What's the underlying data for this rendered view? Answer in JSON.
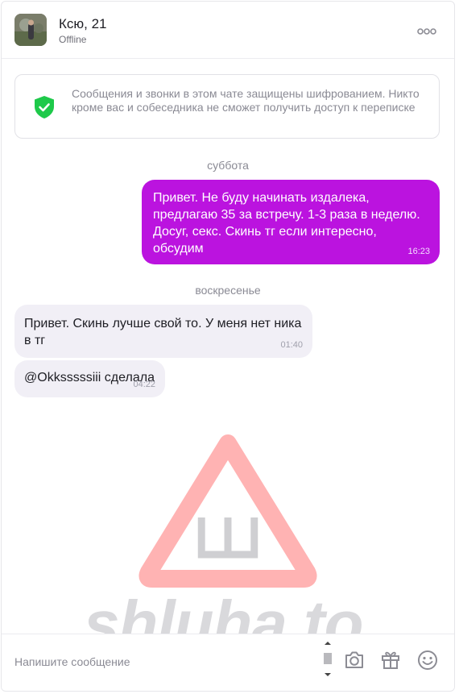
{
  "header": {
    "name": "Ксю, 21",
    "status": "Offline",
    "avatar_icon": "profile-photo",
    "menu_icon": "more-icon"
  },
  "notice": {
    "icon": "shield-check-icon",
    "text": "Сообщения и звонки в этом чате защищены шифрованием. Никто кроме вас и собеседника не сможет получить доступ к переписке"
  },
  "days": [
    {
      "label": "суббота"
    },
    {
      "label": "воскресенье"
    }
  ],
  "messages": [
    {
      "direction": "out",
      "text": "Привет. Не буду начинать издалека, предлагаю 35 за встречу. 1-3 раза в неделю. Досуг, секс. Скинь тг если интересно, обсудим",
      "time": "16:23"
    },
    {
      "direction": "in",
      "text": "Привет. Скинь лучше свой то. У меня нет ника в тг",
      "time": "01:40"
    },
    {
      "direction": "in",
      "text": "@Okksssssiii сделала",
      "time": "04:22"
    }
  ],
  "watermark": {
    "text": "shluha.to",
    "letter": "Ш"
  },
  "composer": {
    "placeholder": "Напишите сообщение",
    "camera_icon": "camera-icon",
    "gift_icon": "gift-icon",
    "emoji_icon": "emoji-icon"
  },
  "colors": {
    "outgoing_bubble": "#bb13df",
    "incoming_bubble": "#f1eff6",
    "shield": "#1ec94a"
  }
}
